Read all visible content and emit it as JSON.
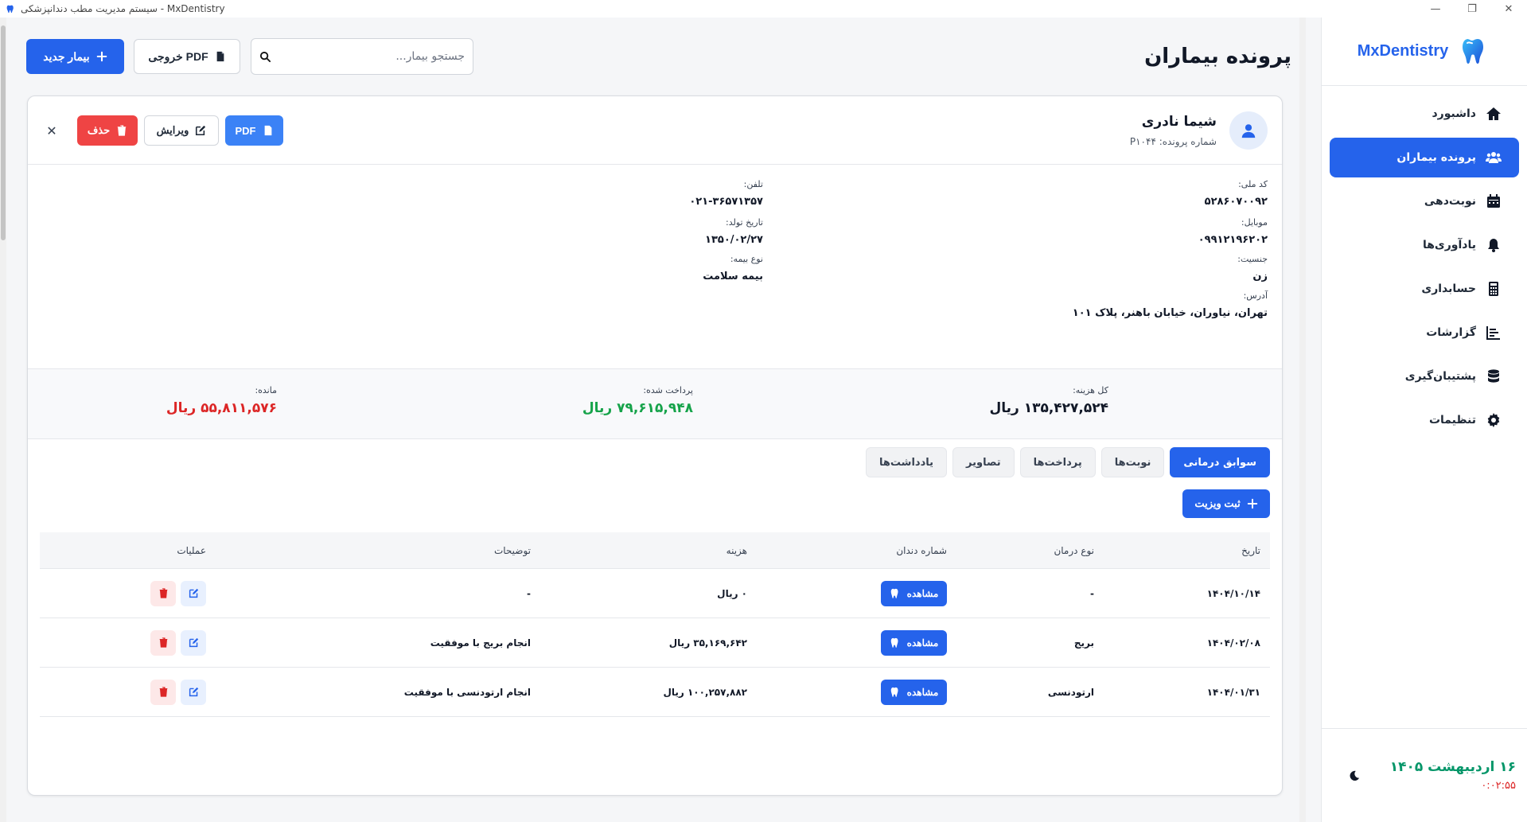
{
  "window": {
    "title": "سیستم مدیریت مطب دندانپزشکی - MxDentistry",
    "controls": [
      "—",
      "❐",
      "✕"
    ]
  },
  "sidebar": {
    "brand": "MxDentistry",
    "items": [
      {
        "label": "داشبورد",
        "icon": "home-icon",
        "active": false
      },
      {
        "label": "پرونده بیماران",
        "icon": "users-icon",
        "active": true
      },
      {
        "label": "نوبت‌دهی",
        "icon": "calendar-icon",
        "active": false
      },
      {
        "label": "یادآوری‌ها",
        "icon": "bell-icon",
        "active": false
      },
      {
        "label": "حسابداری",
        "icon": "calculator-icon",
        "active": false
      },
      {
        "label": "گزارشات",
        "icon": "chart-icon",
        "active": false
      },
      {
        "label": "پشتیبان‌گیری",
        "icon": "database-icon",
        "active": false
      },
      {
        "label": "تنظیمات",
        "icon": "gear-icon",
        "active": false
      }
    ],
    "date": "۱۶ اردیبهشت ۱۴۰۵",
    "time": "۰:۰۲:۵۵"
  },
  "header": {
    "title": "پرونده بیماران",
    "new_patient": "بیمار جدید",
    "export_pdf": "خروجی PDF",
    "search_placeholder": "جستجو بیمار..."
  },
  "patient": {
    "name": "شیما نادری",
    "file_number": "شماره پرونده: P۱۰۴۴",
    "actions": {
      "pdf": "PDF",
      "edit": "ویرایش",
      "delete": "حذف",
      "close": "✕"
    },
    "fields": {
      "national_code": {
        "label": "کد ملی:",
        "value": "۵۲۸۶۰۷۰۰۹۲"
      },
      "phone": {
        "label": "تلفن:",
        "value": "۰۲۱-۳۶۵۷۱۳۵۷"
      },
      "mobile": {
        "label": "موبایل:",
        "value": "۰۹۹۱۲۱۹۶۲۰۲"
      },
      "birth_date": {
        "label": "تاریخ تولد:",
        "value": "۱۳۵۰/۰۲/۲۷"
      },
      "gender": {
        "label": "جنسیت:",
        "value": "زن"
      },
      "insurance": {
        "label": "نوع بیمه:",
        "value": "بیمه سلامت"
      },
      "address": {
        "label": "آدرس:",
        "value": "تهران، نیاوران، خیابان باهنر، پلاک ۱۰۱"
      }
    },
    "totals": {
      "total": {
        "label": "کل هزینه:",
        "value": "۱۳۵,۴۲۷,۵۲۴ ریال",
        "color": "#111827"
      },
      "paid": {
        "label": "پرداخت شده:",
        "value": "۷۹,۶۱۵,۹۴۸ ریال",
        "color": "#16a34a"
      },
      "remaining": {
        "label": "مانده:",
        "value": "۵۵,۸۱۱,۵۷۶ ریال",
        "color": "#dc2626"
      }
    }
  },
  "tabs": [
    {
      "label": "سوابق درمانی",
      "active": true
    },
    {
      "label": "نوبت‌ها",
      "active": false
    },
    {
      "label": "پرداخت‌ها",
      "active": false
    },
    {
      "label": "تصاویر",
      "active": false
    },
    {
      "label": "یادداشت‌ها",
      "active": false
    }
  ],
  "add_visit": "ثبت ویزیت",
  "table": {
    "columns": [
      "تاریخ",
      "نوع درمان",
      "شماره دندان",
      "هزینه",
      "توضیحات",
      "عملیات"
    ],
    "view_label": "مشاهده",
    "rows": [
      {
        "date": "۱۴۰۴/۱۰/۱۴",
        "treatment": "-",
        "cost": "۰ ریال",
        "desc": "-"
      },
      {
        "date": "۱۴۰۴/۰۲/۰۸",
        "treatment": "بریج",
        "cost": "۳۵,۱۶۹,۶۴۲ ریال",
        "desc": "انجام بریج با موفقیت"
      },
      {
        "date": "۱۴۰۴/۰۱/۳۱",
        "treatment": "ارتودنسی",
        "cost": "۱۰۰,۲۵۷,۸۸۲ ریال",
        "desc": "انجام ارتودنسی با موفقیت"
      }
    ]
  },
  "colors": {
    "primary": "#2563eb",
    "danger": "#ef4444",
    "success": "#16a34a"
  }
}
